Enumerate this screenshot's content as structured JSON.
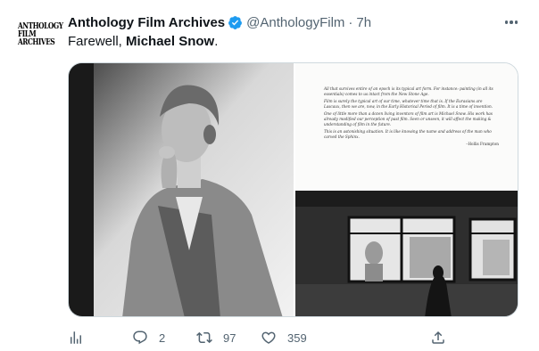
{
  "tweet": {
    "avatar": {
      "lines": [
        "ANTHOLOGY",
        "FILM",
        "ARCHIVES"
      ]
    },
    "author_name": "Anthology Film Archives",
    "handle": "@AnthologyFilm",
    "separator": "·",
    "time": "7h",
    "text_prefix": "Farewell, ",
    "text_bold": "Michael Snow",
    "text_suffix": ".",
    "icons": {
      "verified": "verified-badge-icon",
      "more": "more-options-icon"
    },
    "media": {
      "quote_paragraphs": [
        "All that survives entire of an epoch is its typical art form. For instance: painting (in all its essentials) comes to us intact from the New Stone Age.",
        "Film is surely the typical art of our time, whatever time that is. If the Eurasians are Lascaux, then we are, now, in the Early Historical Period of film. It is a time of invention.",
        "One of little more than a dozen living inventors of film art is Michael Snow. His work has already modified our perception of past film. Seen or unseen, it will affect the making & understanding of film in the future.",
        "This is an astonishing situation. It is like knowing the name and address of the man who carved the Sphinx."
      ],
      "quote_attribution": "–Hollis Frampton"
    },
    "actions": [
      {
        "name": "analytics",
        "icon": "analytics-icon",
        "count": ""
      },
      {
        "name": "reply",
        "icon": "reply-icon",
        "count": "2"
      },
      {
        "name": "retweet",
        "icon": "retweet-icon",
        "count": "97"
      },
      {
        "name": "like",
        "icon": "heart-icon",
        "count": "359"
      },
      {
        "name": "share",
        "icon": "share-icon",
        "count": ""
      }
    ]
  },
  "colors": {
    "text_primary": "#0f1419",
    "text_secondary": "#536471",
    "verified_blue": "#1d9bf0",
    "media_border": "#cfd9de"
  }
}
